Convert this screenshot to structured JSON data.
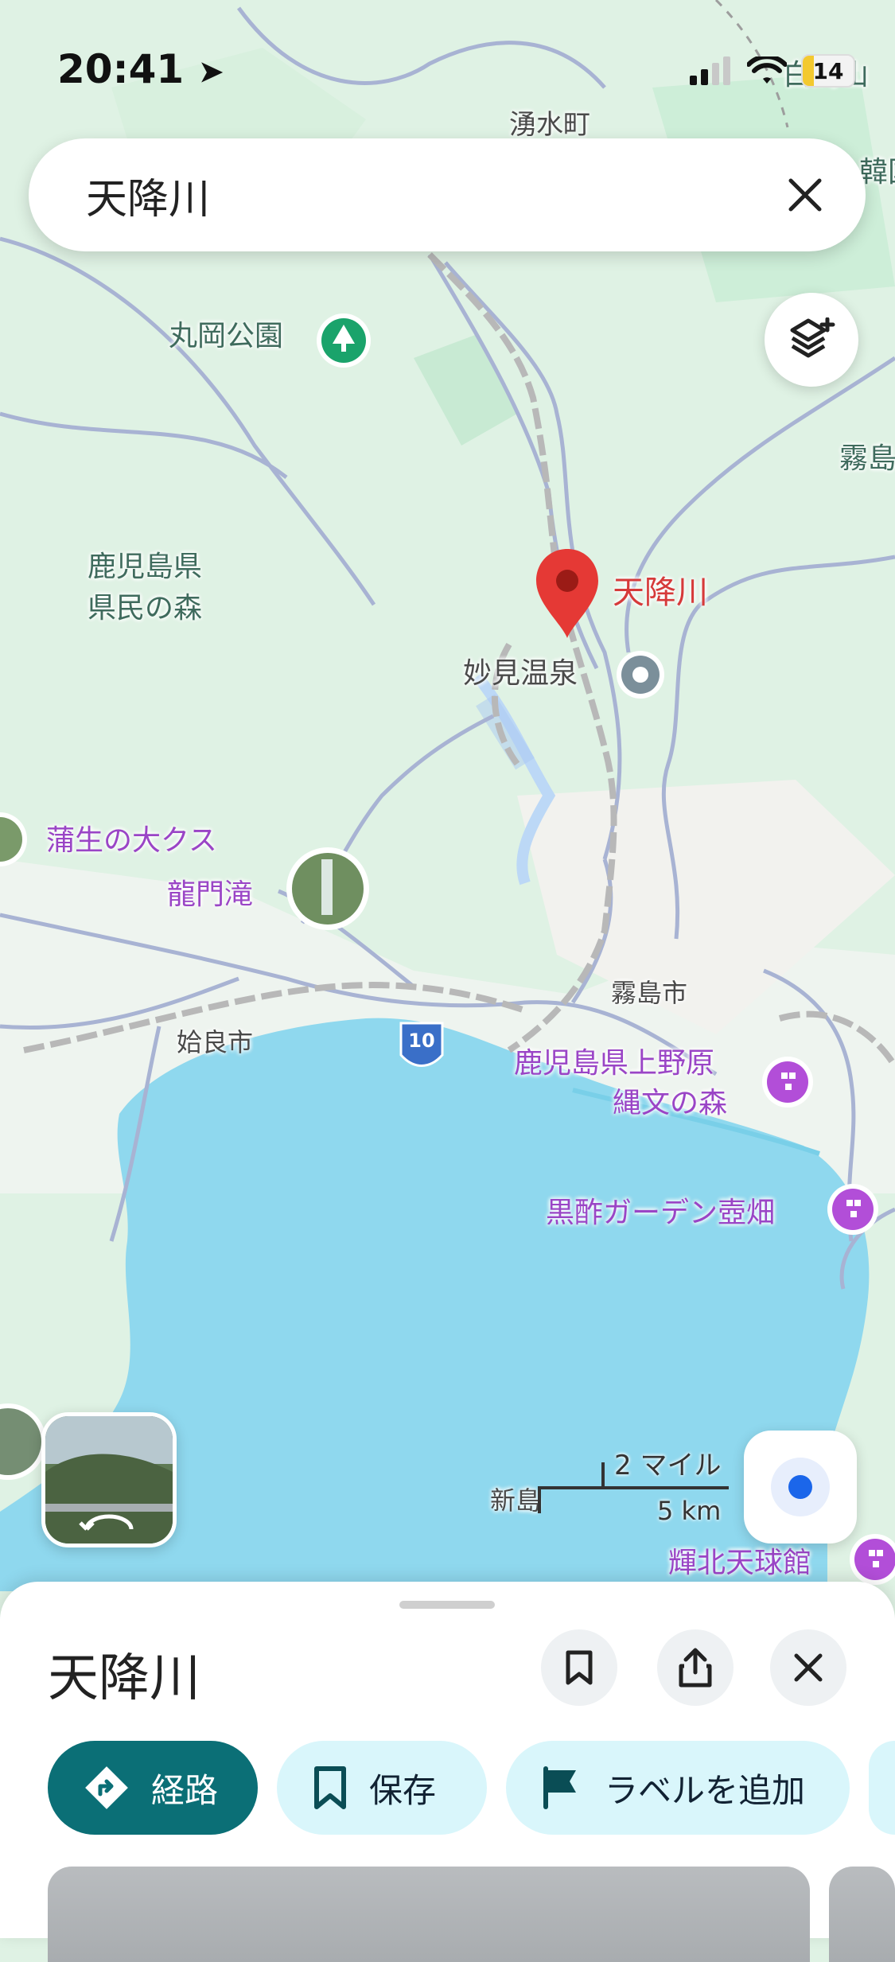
{
  "status_bar": {
    "time": "20:41",
    "battery": "14"
  },
  "search": {
    "query": "天降川"
  },
  "map": {
    "labels": {
      "yusui": "湧水町",
      "shiroyama": "白鳥山",
      "kankoku": "韓国",
      "maruoka": "丸岡公園",
      "kirishima_top": "霧島",
      "kenmin_line1": "鹿児島県",
      "kenmin_line2": "県民の森",
      "pin_label": "天降川",
      "myoken": "妙見温泉",
      "kamou": "蒲生の大クス",
      "ryumon": "龍門滝",
      "kirishima_city": "霧島市",
      "aira": "姶良市",
      "route10": "10",
      "uenohara_line1": "鹿児島県上野原",
      "uenohara_line2": "縄文の森",
      "kurozu": "黒酢ガーデン壺畑",
      "shinjima": "新島",
      "kihoku": "輝北天球館"
    },
    "scale": {
      "miles": "2 マイル",
      "km": "5 km"
    }
  },
  "sheet": {
    "title": "天降川",
    "actions": {
      "directions": "経路",
      "save": "保存",
      "add_label": "ラベルを追加"
    }
  },
  "colors": {
    "water": "#8fd8ee",
    "land": "#dff2e4",
    "road": "#a8b3d3",
    "pin": "#e53935",
    "primary_chip": "#0b6f76",
    "secondary_chip": "#d9f6fb",
    "poi_purple": "#b24ed8",
    "park_green": "#1aa36b"
  }
}
